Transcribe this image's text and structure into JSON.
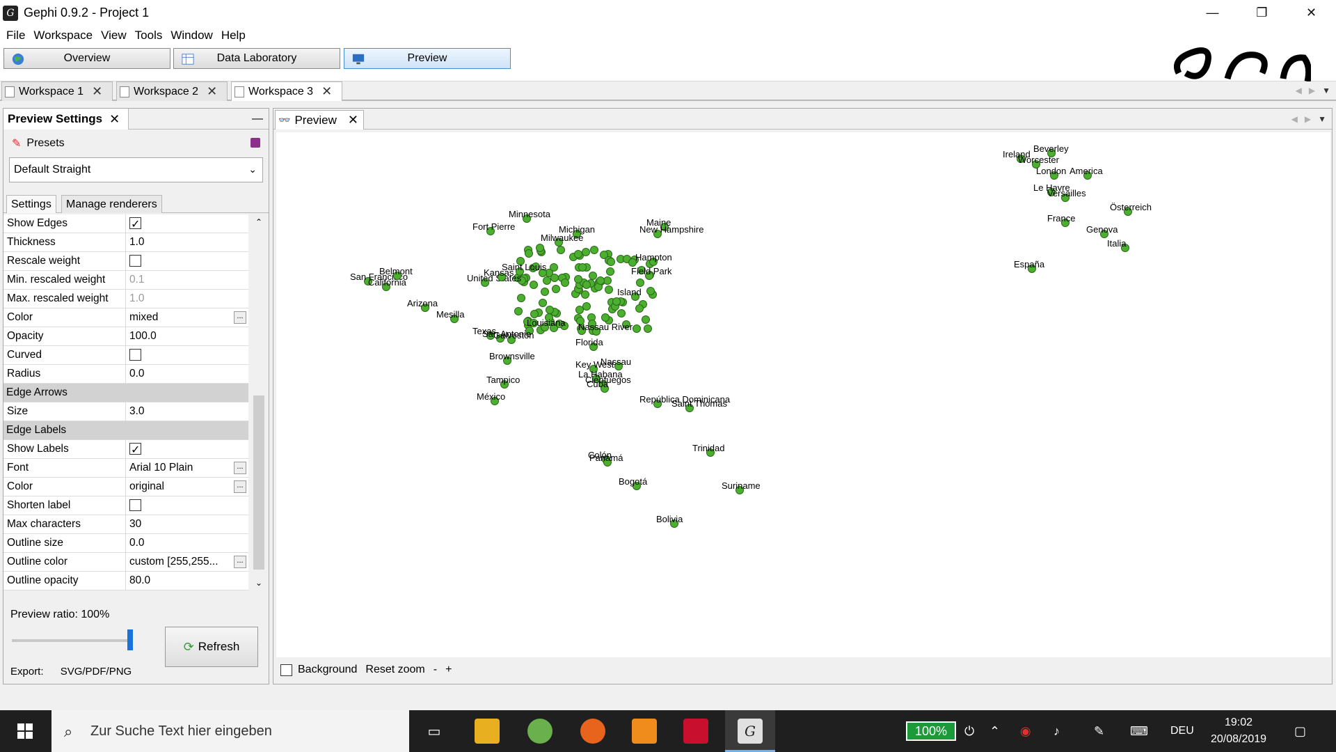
{
  "window": {
    "title": "Gephi 0.9.2 - Project 1",
    "app_icon": "gephi-icon"
  },
  "menu": [
    "File",
    "Workspace",
    "View",
    "Tools",
    "Window",
    "Help"
  ],
  "perspectives": [
    {
      "label": "Overview",
      "icon": "globe-icon"
    },
    {
      "label": "Data Laboratory",
      "icon": "table-icon"
    },
    {
      "label": "Preview",
      "icon": "monitor-icon",
      "active": true
    }
  ],
  "workspace_tabs": [
    {
      "label": "Workspace 1"
    },
    {
      "label": "Workspace 2"
    },
    {
      "label": "Workspace 3",
      "active": true
    }
  ],
  "preview_settings": {
    "panel_title": "Preview Settings",
    "presets_label": "Presets",
    "preset_selected": "Default Straight",
    "tabs": [
      "Settings",
      "Manage renderers"
    ],
    "properties": [
      {
        "name": "Show Edges",
        "type": "checkbox",
        "checked": true
      },
      {
        "name": "Thickness",
        "value": "1.0"
      },
      {
        "name": "Rescale weight",
        "type": "checkbox",
        "checked": false
      },
      {
        "name": "Min. rescaled weight",
        "value": "0.1",
        "disabled": true
      },
      {
        "name": "Max. rescaled weight",
        "value": "1.0",
        "disabled": true
      },
      {
        "name": "Color",
        "value": "mixed",
        "dots": true
      },
      {
        "name": "Opacity",
        "value": "100.0"
      },
      {
        "name": "Curved",
        "type": "checkbox",
        "checked": false
      },
      {
        "name": "Radius",
        "value": "0.0"
      },
      {
        "name": "Edge Arrows",
        "type": "section"
      },
      {
        "name": "Size",
        "value": "3.0"
      },
      {
        "name": "Edge Labels",
        "type": "section"
      },
      {
        "name": "Show Labels",
        "type": "checkbox",
        "checked": true
      },
      {
        "name": "Font",
        "value": "Arial 10 Plain",
        "dots": true
      },
      {
        "name": "Color",
        "value": "original",
        "dots": true
      },
      {
        "name": "Shorten label",
        "type": "checkbox",
        "checked": false
      },
      {
        "name": "Max characters",
        "value": "30"
      },
      {
        "name": "Outline size",
        "value": "0.0"
      },
      {
        "name": "Outline color",
        "value": "custom [255,255...",
        "dots": true
      },
      {
        "name": "Outline opacity",
        "value": "80.0"
      }
    ],
    "preview_ratio": "Preview ratio:  100%",
    "preview_ratio_value": 1.0,
    "refresh_label": "Refresh",
    "export_label": "Export:",
    "export_formats": "SVG/PDF/PNG"
  },
  "preview": {
    "tab_label": "Preview",
    "background_label": "Background",
    "reset_zoom_label": "Reset zoom",
    "zoom_out": "-",
    "zoom_in": "+",
    "node_color": "#4caf30",
    "nodes": [
      {
        "label": "Minnesota"
      },
      {
        "label": "Fort Pierre"
      },
      {
        "label": "Michigan"
      },
      {
        "label": "Milwaukee"
      },
      {
        "label": "Maine"
      },
      {
        "label": "New Hampshire"
      },
      {
        "label": "San Francisco"
      },
      {
        "label": "Belmont"
      },
      {
        "label": "California"
      },
      {
        "label": "Arizona"
      },
      {
        "label": "Mesilla"
      },
      {
        "label": "Louisiana"
      },
      {
        "label": "Texas"
      },
      {
        "label": "San Antonio"
      },
      {
        "label": "Galveston"
      },
      {
        "label": "Nassau River"
      },
      {
        "label": "Florida"
      },
      {
        "label": "Brownsville"
      },
      {
        "label": "Key West"
      },
      {
        "label": "Nassau"
      },
      {
        "label": "La Habana"
      },
      {
        "label": "Cienfuegos"
      },
      {
        "label": "Cuba"
      },
      {
        "label": "Tampico"
      },
      {
        "label": "México"
      },
      {
        "label": "República Dominicana"
      },
      {
        "label": "Saint Thomas"
      },
      {
        "label": "Trinidad"
      },
      {
        "label": "Colón"
      },
      {
        "label": "Panamá"
      },
      {
        "label": "Bogotá"
      },
      {
        "label": "Suriname"
      },
      {
        "label": "Bolivia"
      },
      {
        "label": "Ireland"
      },
      {
        "label": "Beverley"
      },
      {
        "label": "Worcester"
      },
      {
        "label": "London"
      },
      {
        "label": "America"
      },
      {
        "label": "Le Havre"
      },
      {
        "label": "Versailles"
      },
      {
        "label": "Österreich"
      },
      {
        "label": "France"
      },
      {
        "label": "Genova"
      },
      {
        "label": "Italia"
      },
      {
        "label": "España"
      },
      {
        "label": "Hampton"
      },
      {
        "label": "Field Park"
      },
      {
        "label": "Island"
      },
      {
        "label": "Saint Louis"
      },
      {
        "label": "United States"
      },
      {
        "label": "Kansas"
      }
    ]
  },
  "taskbar": {
    "search_placeholder": "Zur Suche Text hier eingeben",
    "battery": "100%",
    "language": "DEU",
    "time": "19:02",
    "date": "20/08/2019"
  }
}
